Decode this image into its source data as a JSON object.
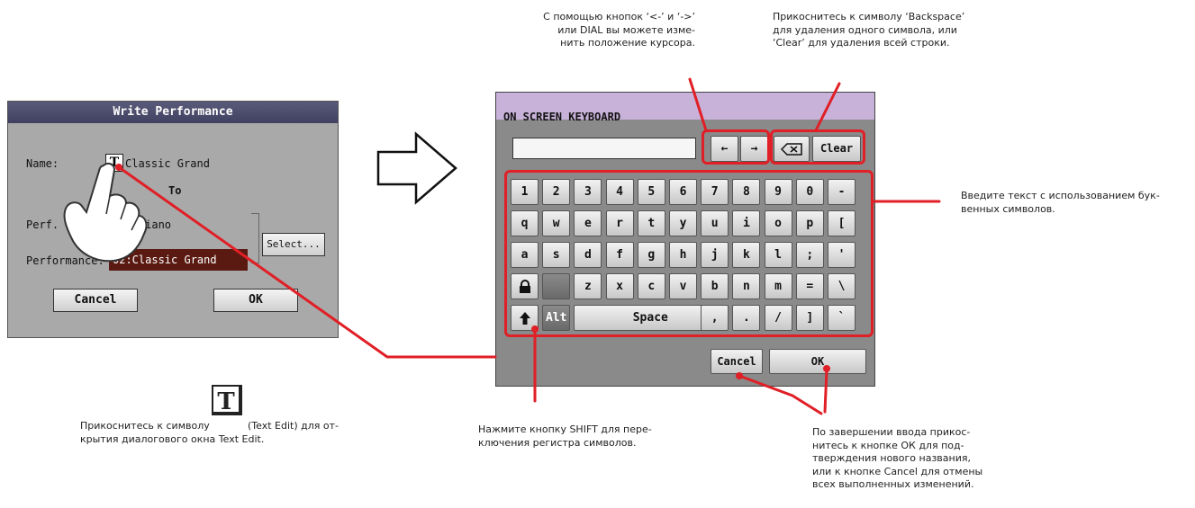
{
  "write_dialog": {
    "title": "Write Performance",
    "name_label": "Name:",
    "name_value": "Classic Grand",
    "to_label": "To",
    "perf_label": "Perf.",
    "perf_value": "B01:Piano",
    "select_button": "Select...",
    "performance_label": "Performance:",
    "performance_value": "02:Classic Grand",
    "cancel_button": "Cancel",
    "ok_button": "OK",
    "text_edit_icon": "T"
  },
  "keyboard": {
    "title": "ON SCREEN KEYBOARD",
    "left_arrow": "←",
    "right_arrow": "→",
    "backspace_icon": "backspace-icon",
    "clear_button": "Clear",
    "rows": [
      [
        "1",
        "2",
        "3",
        "4",
        "5",
        "6",
        "7",
        "8",
        "9",
        "0",
        "-"
      ],
      [
        "q",
        "w",
        "e",
        "r",
        "t",
        "y",
        "u",
        "i",
        "o",
        "p",
        "["
      ],
      [
        "a",
        "s",
        "d",
        "f",
        "g",
        "h",
        "j",
        "k",
        "l",
        ";",
        "'"
      ],
      [
        "lock",
        "",
        "z",
        "x",
        "c",
        "v",
        "b",
        "n",
        "m",
        "=",
        "\\"
      ],
      [
        "shift",
        "Alt",
        "Space",
        ",",
        ".",
        "/",
        "]",
        "`"
      ]
    ],
    "lock_icon": "lock-icon",
    "shift_icon": "shift-arrow-icon",
    "alt_label": "Alt",
    "space_label": "Space",
    "cancel_button": "Cancel",
    "ok_button": "OK"
  },
  "callouts": {
    "cursor": "С помощью кнопок ‘<-’ и ‘->’\nили DIAL вы можете изме-\nнить положение курсора.",
    "backspace": "Прикоснитесь к символу ‘Backspace’\nдля удаления одного символа, или\n‘Clear’ для удаления всей строки.",
    "letters": "Введите текст с использованием бук-\nвенных символов.",
    "shift": "Нажмите кнопку SHIFT для пере-\nключения регистра символов.",
    "ok_cancel": "По завершении ввода прикос-\nнитесь к кнопке ОК для под-\nтверждения нового названия,\nили к кнопке Cancel для отмены\nвсех выполненных изменений.",
    "text_edit_before": "Прикоснитесь к символу",
    "text_edit_after": "(Text Edit) для от-",
    "text_edit_line2": "крытия диалогового окна Text Edit."
  },
  "colors": {
    "highlight": "#e01f26",
    "keyboard_title": "#c9b2d9",
    "dialog_bg": "#a9a9a9"
  }
}
